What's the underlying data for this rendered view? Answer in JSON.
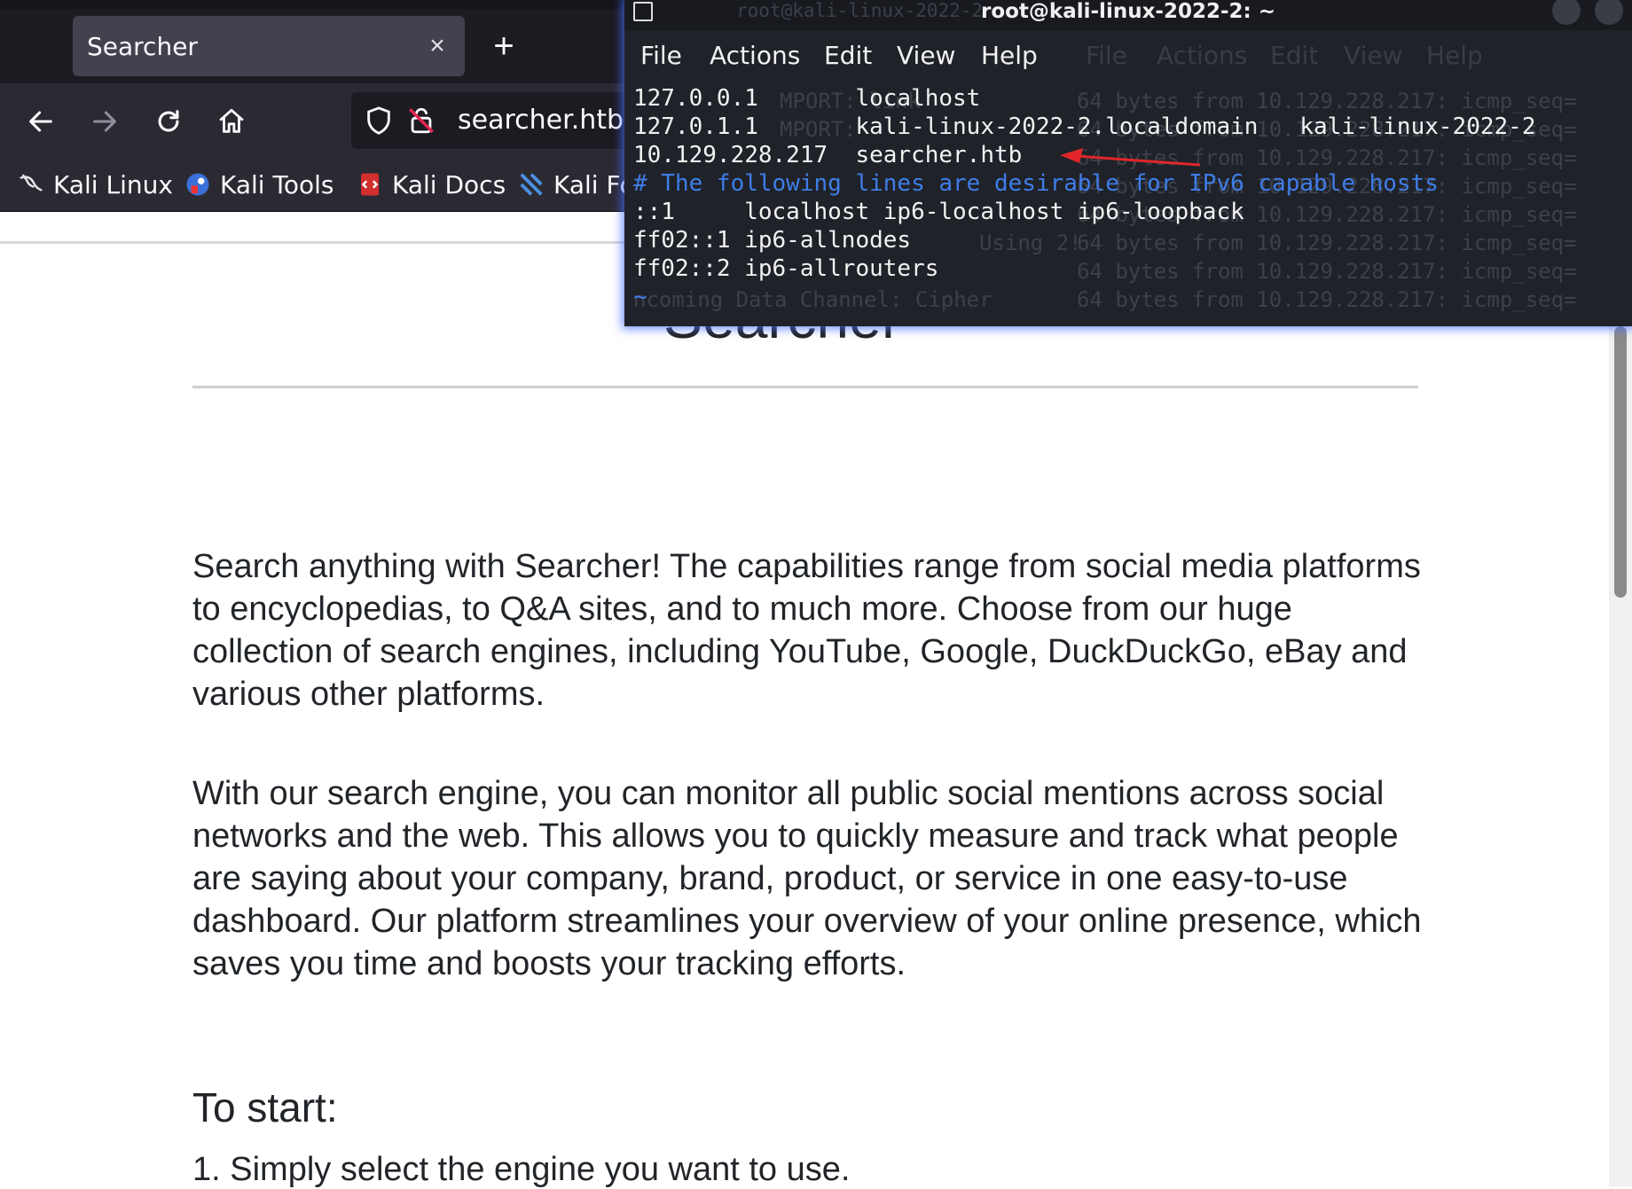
{
  "browser": {
    "tab_title": "Searcher",
    "tab_close": "×",
    "new_tab": "+",
    "url": "searcher.htb",
    "bookmarks": [
      {
        "label": "Kali Linux",
        "icon": "kali-dragon-icon"
      },
      {
        "label": "Kali Tools",
        "icon": "kali-tools-icon"
      },
      {
        "label": "Kali Docs",
        "icon": "kali-docs-icon"
      },
      {
        "label": "Kali Fo",
        "icon": "kali-forums-icon"
      }
    ]
  },
  "page": {
    "heading": "Searcher",
    "paragraph1": "Search anything with Searcher! The capabilities range from social media platforms to encyclopedias, to Q&A sites, and to much more. Choose from our huge collection of search engines, including YouTube, Google, DuckDuckGo, eBay and various other platforms.",
    "paragraph2": "With our search engine, you can monitor all public social mentions across social networks and the web. This allows you to quickly measure and track what people are saying about your company, brand, product, or service in one easy-to-use dashboard. Our platform streamlines your overview of your online presence, which saves you time and boosts your tracking efforts.",
    "to_start": "To start:",
    "step1": "1. Simply select the engine you want to use."
  },
  "terminal": {
    "title": "root@kali-linux-2022-2: ~",
    "menu": [
      "File",
      "Actions",
      "Edit",
      "View",
      "Help"
    ],
    "lines": [
      "127.0.0.1       localhost",
      "127.0.1.1       kali-linux-2022-2.localdomain   kali-linux-2022-2",
      "10.129.228.217  searcher.htb",
      "# The following lines are desirable for IPv6 capable hosts",
      "::1     localhost ip6-localhost ip6-loopback",
      "ff02::1 ip6-allnodes",
      "ff02::2 ip6-allrouters",
      "~"
    ],
    "background_title": "root@kali-linux-2022-2",
    "background_menu": [
      "File",
      "Actions",
      "Edit",
      "View",
      "Help"
    ],
    "background_fragments": [
      "MPORT: link",
      "MPORT: ",
      "Using 2!",
      "ncoming Data Channel: Cipher"
    ],
    "background_ping": "64 bytes from 10.129.228.217: icmp_seq="
  },
  "colors": {
    "accent_arrow": "#e0262a",
    "comment": "#3f7de8",
    "glow": "#4a6cff"
  }
}
